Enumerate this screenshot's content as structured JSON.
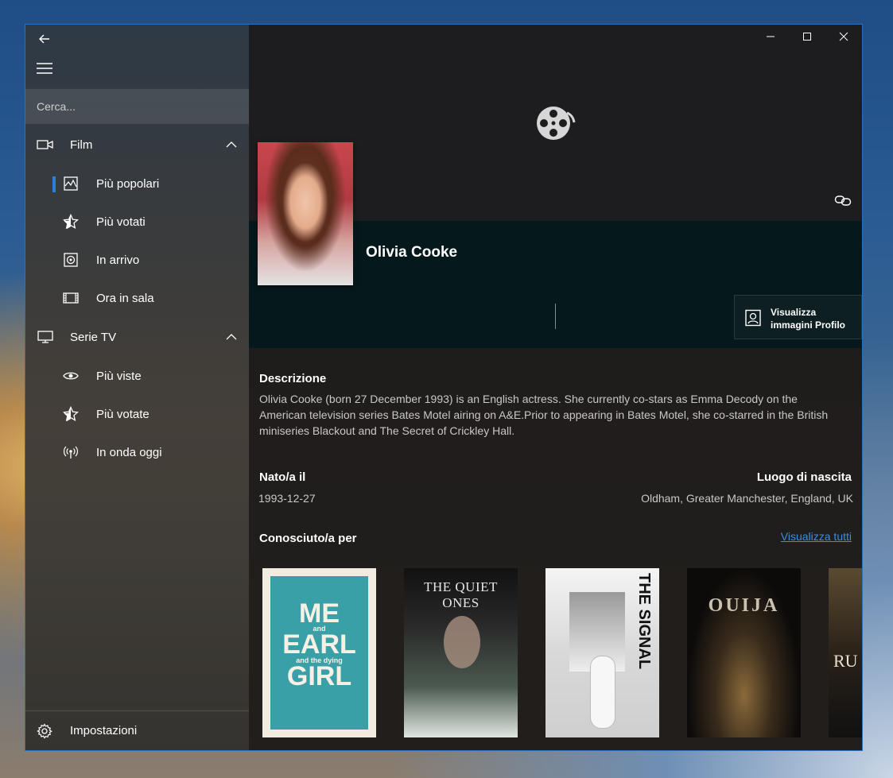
{
  "sidebar": {
    "search_placeholder": "Cerca...",
    "groups": [
      {
        "label": "Film",
        "items": [
          {
            "label": "Più popolari",
            "icon": "chart-icon",
            "selected": true
          },
          {
            "label": "Più votati",
            "icon": "star-icon",
            "selected": false
          },
          {
            "label": "In arrivo",
            "icon": "upcoming-icon",
            "selected": false
          },
          {
            "label": "Ora in sala",
            "icon": "film-strip-icon",
            "selected": false
          }
        ]
      },
      {
        "label": "Serie TV",
        "items": [
          {
            "label": "Più viste",
            "icon": "eye-icon",
            "selected": false
          },
          {
            "label": "Più votate",
            "icon": "star-icon",
            "selected": false
          },
          {
            "label": "In onda oggi",
            "icon": "broadcast-icon",
            "selected": false
          }
        ]
      }
    ],
    "settings_label": "Impostazioni"
  },
  "person": {
    "name": "Olivia Cooke",
    "view_images_label": "Visualizza immagini Profilo",
    "description_title": "Descrizione",
    "description": "Olivia Cooke (born 27 December 1993) is an English actress. She currently co-stars as Emma Decody on the American television series Bates Motel airing on A&E.Prior to appearing in Bates Motel, she co-starred in the British miniseries Blackout and The Secret of Crickley Hall.",
    "born_label": "Nato/a il",
    "born_value": "1993-12-27",
    "birthplace_label": "Luogo di nascita",
    "birthplace_value": "Oldham, Greater Manchester, England, UK",
    "known_for_label": "Conosciuto/a per",
    "view_all_label": "Visualizza tutti"
  },
  "known_for": [
    {
      "title_lines": [
        "ME",
        "and",
        "EARL",
        "and the dying",
        "GIRL"
      ]
    },
    {
      "title": "THE QUIET ONES"
    },
    {
      "title": "THE SIGNAL"
    },
    {
      "title": "OUIJA"
    },
    {
      "title": "RU"
    }
  ],
  "colors": {
    "accent": "#2a7fd8",
    "link": "#3a8ee6",
    "band": "#05191c",
    "window_border": "#2b6fbf"
  }
}
